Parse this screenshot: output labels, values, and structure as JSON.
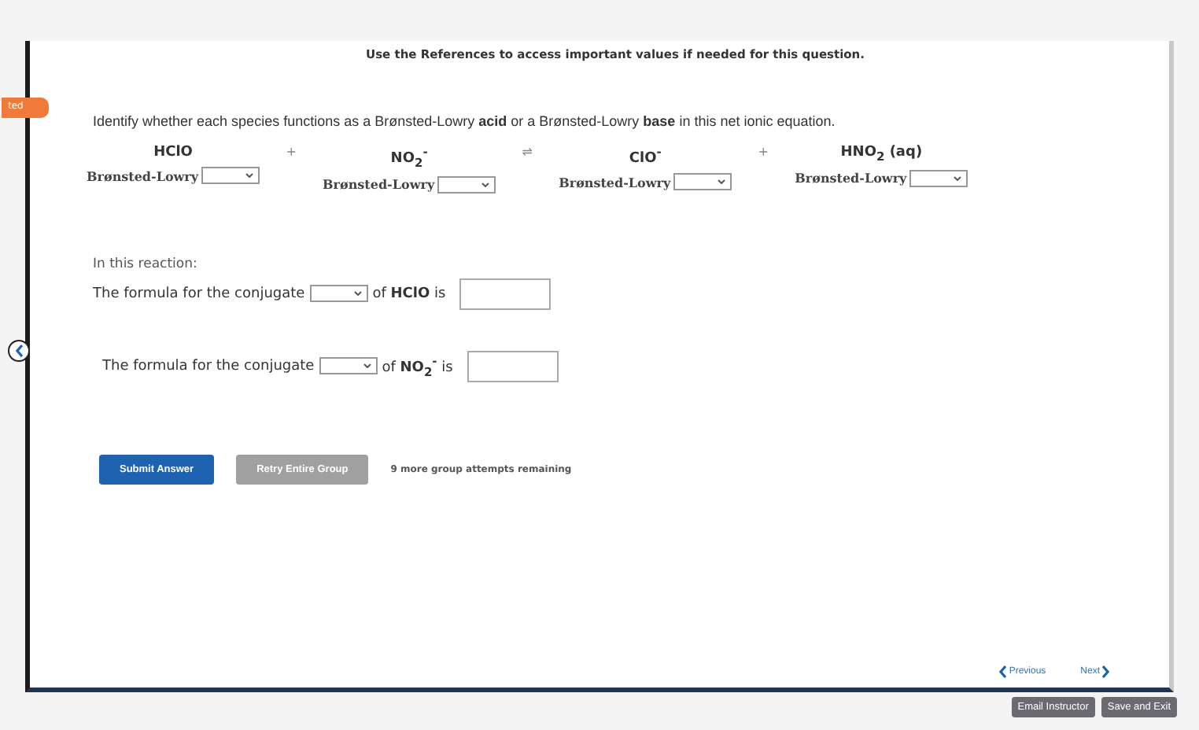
{
  "header": {
    "notice": "Use the References to access important values if needed for this question."
  },
  "side_tab": {
    "label": "ted"
  },
  "question": {
    "prompt": "Identify whether each species functions as a Brønsted-Lowry **acid** or a Brønsted-Lowry **base** in this net ionic equation."
  },
  "equation": [
    {
      "kind": "species",
      "formula": "HClO",
      "label": "Brønsted-Lowry"
    },
    {
      "kind": "operator",
      "symbol": "+"
    },
    {
      "kind": "species",
      "formula": "NO$_{2}$$^{-}$",
      "label": "Brønsted-Lowry"
    },
    {
      "kind": "operator",
      "symbol": "⇌"
    },
    {
      "kind": "species",
      "formula": "ClO$^{-}$",
      "label": "Brønsted-Lowry"
    },
    {
      "kind": "operator",
      "symbol": "+"
    },
    {
      "kind": "species",
      "formula": "HNO$_{2}$ (aq)",
      "label": "Brønsted-Lowry"
    }
  ],
  "conjugates": {
    "intro": "In this reaction:",
    "rows": [
      {
        "lead": "The formula for the conjugate",
        "tail": "of **HClO** is"
      },
      {
        "lead": "The formula for the conjugate",
        "tail": "of **NO$_{2}$$^{-}$** is"
      }
    ]
  },
  "actions": {
    "buttons": [
      {
        "label": "Submit Answer",
        "kind": "primary"
      },
      {
        "label": "Retry Entire Group",
        "kind": "secondary"
      }
    ],
    "attempts": "9 more group attempts remaining"
  },
  "navigation": {
    "previous": "Previous",
    "next": "Next"
  },
  "footer": {
    "buttons": [
      "Email Instructor",
      "Save and Exit"
    ]
  }
}
